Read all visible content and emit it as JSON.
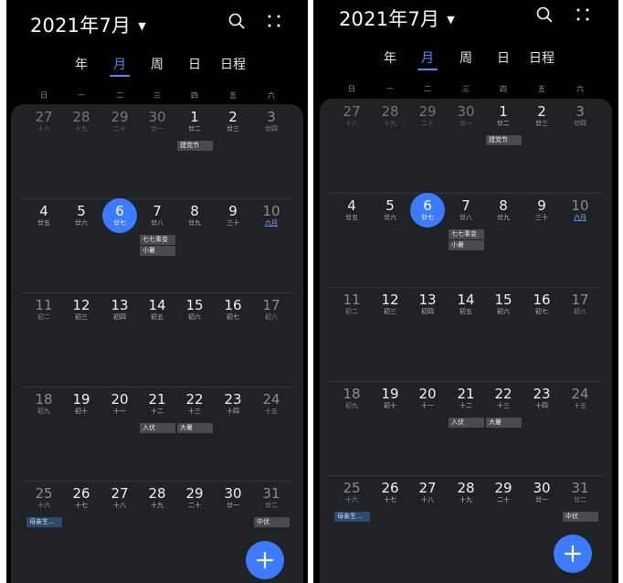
{
  "app": {
    "title": "2021年7月",
    "tabs": [
      "年",
      "月",
      "周",
      "日",
      "日程"
    ],
    "active_tab": "月",
    "weekdays": [
      "日",
      "一",
      "二",
      "三",
      "四",
      "五",
      "六"
    ]
  },
  "weeks": [
    [
      {
        "day": "27",
        "lunar": "十八",
        "other": true
      },
      {
        "day": "28",
        "lunar": "十九",
        "other": true
      },
      {
        "day": "29",
        "lunar": "二十",
        "other": true
      },
      {
        "day": "30",
        "lunar": "廿一",
        "other": true
      },
      {
        "day": "1",
        "lunar": "廿二"
      },
      {
        "day": "2",
        "lunar": "廿三"
      },
      {
        "day": "3",
        "lunar": "廿四",
        "weekend": true
      }
    ],
    [
      {
        "day": "4",
        "lunar": "廿五"
      },
      {
        "day": "5",
        "lunar": "廿六"
      },
      {
        "day": "6",
        "lunar": "廿七",
        "today": true
      },
      {
        "day": "7",
        "lunar": "廿八"
      },
      {
        "day": "8",
        "lunar": "廿九"
      },
      {
        "day": "9",
        "lunar": "三十"
      },
      {
        "day": "10",
        "lunar": "六月",
        "weekend": true,
        "month_label": true
      }
    ],
    [
      {
        "day": "11",
        "lunar": "初二",
        "weekend": true
      },
      {
        "day": "12",
        "lunar": "初三"
      },
      {
        "day": "13",
        "lunar": "初四"
      },
      {
        "day": "14",
        "lunar": "初五"
      },
      {
        "day": "15",
        "lunar": "初六"
      },
      {
        "day": "16",
        "lunar": "初七"
      },
      {
        "day": "17",
        "lunar": "初八",
        "weekend": true
      }
    ],
    [
      {
        "day": "18",
        "lunar": "初九",
        "weekend": true
      },
      {
        "day": "19",
        "lunar": "初十"
      },
      {
        "day": "20",
        "lunar": "十一"
      },
      {
        "day": "21",
        "lunar": "十二"
      },
      {
        "day": "22",
        "lunar": "十三"
      },
      {
        "day": "23",
        "lunar": "十四"
      },
      {
        "day": "24",
        "lunar": "十五",
        "weekend": true
      }
    ],
    [
      {
        "day": "25",
        "lunar": "十六",
        "weekend": true
      },
      {
        "day": "26",
        "lunar": "十七"
      },
      {
        "day": "27",
        "lunar": "十八"
      },
      {
        "day": "28",
        "lunar": "十九"
      },
      {
        "day": "29",
        "lunar": "二十"
      },
      {
        "day": "30",
        "lunar": "廿一"
      },
      {
        "day": "31",
        "lunar": "廿二",
        "weekend": true
      }
    ]
  ],
  "events": [
    {
      "week": 0,
      "col": 4,
      "span": 1,
      "slot": 0,
      "label": "建党节"
    },
    {
      "week": 1,
      "col": 3,
      "span": 1,
      "slot": 0,
      "label": "七七事变"
    },
    {
      "week": 1,
      "col": 3,
      "span": 1,
      "slot": 1,
      "label": "小暑"
    },
    {
      "week": 3,
      "col": 3,
      "span": 1,
      "slot": 0,
      "label": "入伏"
    },
    {
      "week": 3,
      "col": 4,
      "span": 1,
      "slot": 0,
      "label": "大暑"
    },
    {
      "week": 4,
      "col": 0,
      "span": 1,
      "slot": 0,
      "label": "母亲生...",
      "blue": true
    },
    {
      "week": 4,
      "col": 6,
      "span": 1,
      "slot": 0,
      "label": "中伏"
    }
  ],
  "icons": {
    "search": "search-icon",
    "more": "more-dots-icon",
    "add": "plus-icon",
    "caret": "caret-down-icon"
  },
  "colors": {
    "background": "#000000",
    "panel": "#212226",
    "accent": "#3c7bff",
    "event": "#4a4b50"
  }
}
